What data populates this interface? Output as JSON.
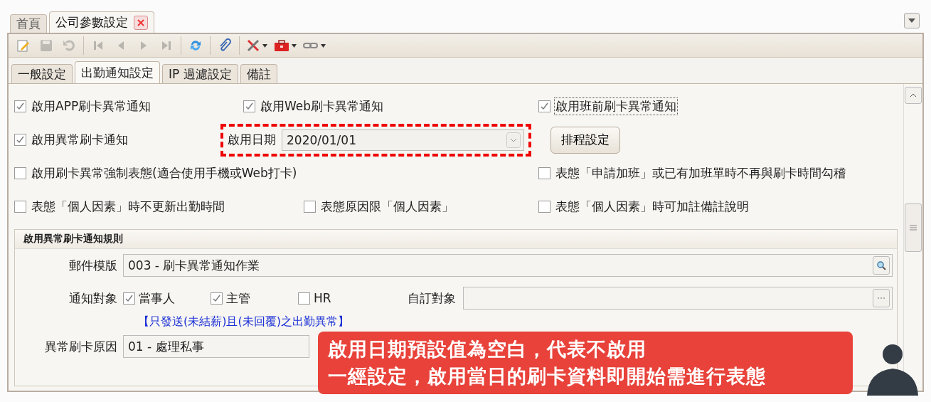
{
  "page_tabs": [
    {
      "label": "首頁",
      "selected": false,
      "closable": false
    },
    {
      "label": "公司參數設定",
      "selected": true,
      "closable": true
    }
  ],
  "toolbar": [
    {
      "disabled": false,
      "dropdown": false
    },
    {
      "disabled": true,
      "dropdown": false
    },
    {
      "disabled": true,
      "dropdown": false
    },
    {
      "disabled": true,
      "dropdown": false
    },
    {
      "disabled": true,
      "dropdown": false
    },
    {
      "disabled": true,
      "dropdown": false
    },
    {
      "disabled": true,
      "dropdown": false
    },
    {
      "disabled": false,
      "dropdown": false
    },
    {
      "disabled": false,
      "dropdown": false
    },
    {
      "disabled": false,
      "dropdown": true
    },
    {
      "disabled": false,
      "dropdown": true
    },
    {
      "disabled": false,
      "dropdown": true
    }
  ],
  "form_tabs": [
    {
      "label": "一般設定",
      "selected": false
    },
    {
      "label": "出勤通知設定",
      "selected": true
    },
    {
      "label": "IP 過濾設定",
      "selected": false
    },
    {
      "label": "備註",
      "selected": false
    }
  ],
  "option_rows": [
    [
      {
        "kind": "checkbox",
        "label": "啟用APP刷卡異常通知",
        "checked": true
      },
      {
        "kind": "checkbox",
        "label": "啟用Web刷卡異常通知",
        "checked": true
      },
      {
        "kind": "checkbox",
        "label": "啟用班前刷卡異常通知",
        "checked": true,
        "focused": true
      }
    ],
    [
      {
        "kind": "checkbox",
        "label": "啟用異常刷卡通知",
        "checked": true
      },
      {
        "kind": "date",
        "label": "啟用日期",
        "value": "2020/01/01",
        "highlighted": true
      },
      {
        "kind": "button",
        "label": "排程設定"
      }
    ],
    [
      {
        "kind": "checkbox",
        "label": "啟用刷卡異常強制表態(適合使用手機或Web打卡)",
        "checked": false
      },
      {
        "kind": "checkbox",
        "label": "表態「申請加班」或已有加班單時不再與刷卡時間勾稽",
        "checked": false
      }
    ],
    [
      {
        "kind": "checkbox",
        "label": "表態「個人因素」時不更新出勤時間",
        "checked": false
      },
      {
        "kind": "checkbox",
        "label": "表態原因限「個人因素」",
        "checked": false
      },
      {
        "kind": "checkbox",
        "label": "表態「個人因素」時可加註備註說明",
        "checked": false
      }
    ]
  ],
  "rules": {
    "title": "啟用異常刷卡通知規則",
    "mail_template": {
      "label": "郵件模版",
      "value": "003 - 刷卡異常通知作業"
    },
    "recipients": {
      "label": "通知對象",
      "options": [
        {
          "label": "當事人",
          "checked": true
        },
        {
          "label": "主管",
          "checked": true
        },
        {
          "label": "HR",
          "checked": false
        }
      ],
      "custom_label": "自訂對象"
    },
    "note": "【只發送(未結薪)且(未回覆)之出勤異常】",
    "reason": {
      "label": "異常刷卡原因",
      "value": "01 - 處理私事"
    }
  },
  "callout": {
    "lines": [
      "啟用日期預設值為空白，代表不啟用",
      "一經設定，啟用當日的刷卡資料即開始需進行表態"
    ]
  }
}
